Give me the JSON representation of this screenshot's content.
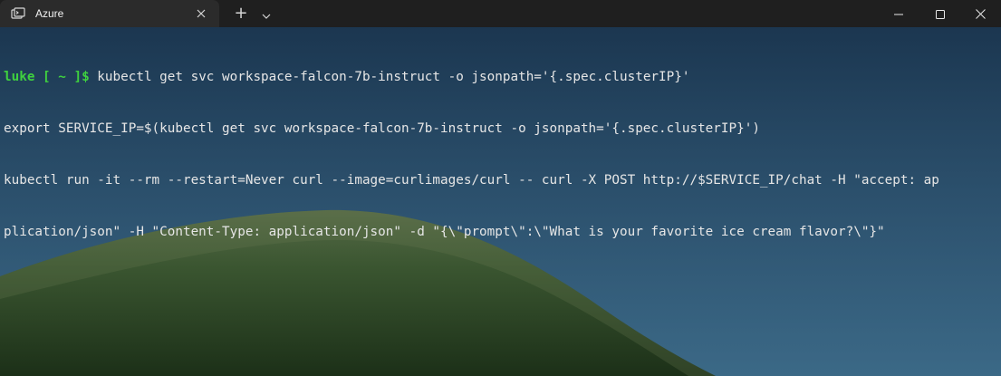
{
  "titlebar": {
    "tab_title": "Azure",
    "new_tab_label": "+",
    "dropdown_icon": "chevron-down-icon"
  },
  "window_controls": {
    "minimize_icon": "minimize-icon",
    "maximize_icon": "maximize-icon",
    "close_icon": "close-icon"
  },
  "terminal": {
    "prompt": "luke [ ~ ]$",
    "lines": [
      " kubectl get svc workspace-falcon-7b-instruct -o jsonpath='{.spec.clusterIP}'",
      "export SERVICE_IP=$(kubectl get svc workspace-falcon-7b-instruct -o jsonpath='{.spec.clusterIP}')",
      "kubectl run -it --rm --restart=Never curl --image=curlimages/curl -- curl -X POST http://$SERVICE_IP/chat -H \"accept: ap",
      "plication/json\" -H \"Content-Type: application/json\" -d \"{\\\"prompt\\\":\\\"What is your favorite ice cream flavor?\\\"}\""
    ]
  },
  "colors": {
    "titlebar_bg": "#1f1f1f",
    "tab_bg": "#2b2b2b",
    "prompt_green": "#3fd13f",
    "text": "#e6e6e6"
  }
}
